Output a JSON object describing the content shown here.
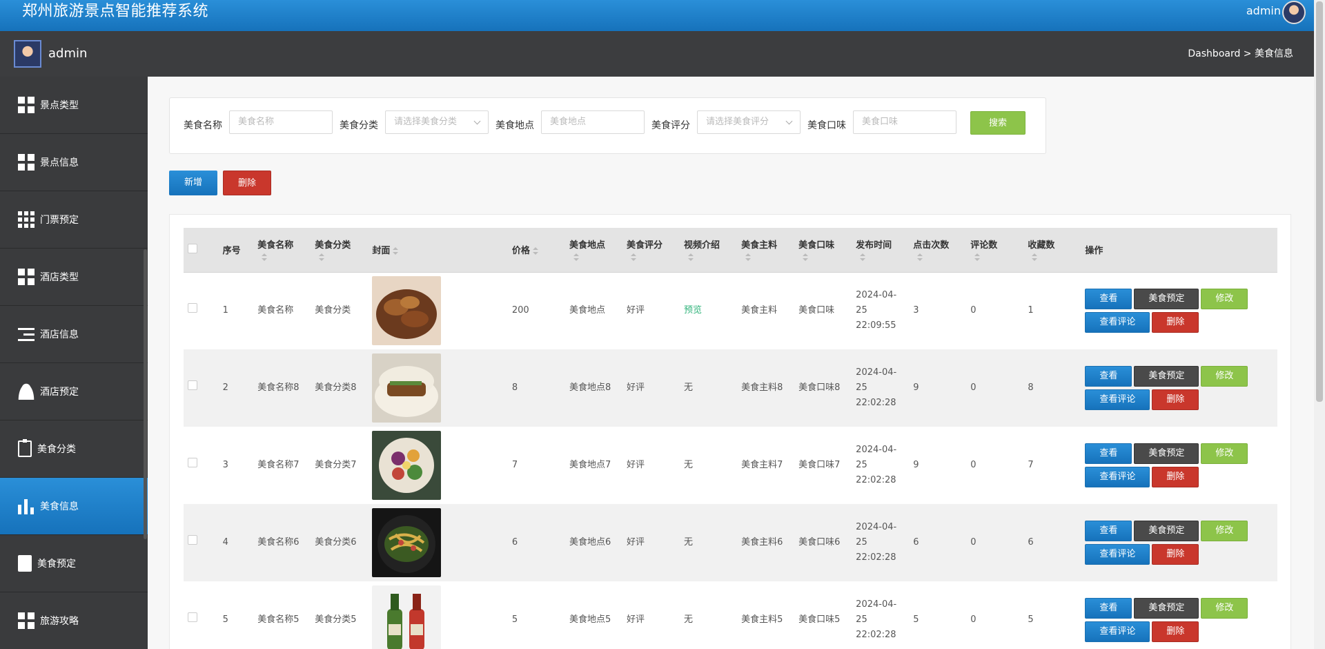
{
  "header": {
    "title": "郑州旅游景点智能推荐系统",
    "user": "admin"
  },
  "subbar": {
    "user": "admin",
    "breadcrumb": "Dashboard > 美食信息"
  },
  "sidebar": {
    "items": [
      {
        "label": "景点类型",
        "icon": "grid-icon"
      },
      {
        "label": "景点信息",
        "icon": "grid-icon"
      },
      {
        "label": "门票预定",
        "icon": "apps-icon"
      },
      {
        "label": "酒店类型",
        "icon": "grid-icon"
      },
      {
        "label": "酒店信息",
        "icon": "list-icon"
      },
      {
        "label": "酒店预定",
        "icon": "user-icon"
      },
      {
        "label": "美食分类",
        "icon": "clipboard-x-icon"
      },
      {
        "label": "美食信息",
        "icon": "bar-chart-icon",
        "active": true
      },
      {
        "label": "美食预定",
        "icon": "clipboard-check-icon"
      },
      {
        "label": "旅游攻略",
        "icon": "grid-icon"
      }
    ]
  },
  "filters": {
    "name_label": "美食名称",
    "name_placeholder": "美食名称",
    "category_label": "美食分类",
    "category_placeholder": "请选择美食分类",
    "location_label": "美食地点",
    "location_placeholder": "美食地点",
    "rating_label": "美食评分",
    "rating_placeholder": "请选择美食评分",
    "taste_label": "美食口味",
    "taste_placeholder": "美食口味",
    "search_label": "搜索"
  },
  "actions": {
    "add_label": "新增",
    "delete_label": "删除"
  },
  "table": {
    "headers": {
      "seq": "序号",
      "name": "美食名称",
      "category": "美食分类",
      "cover": "封面",
      "price": "价格",
      "location": "美食地点",
      "rating": "美食评分",
      "video": "视频介绍",
      "main": "美食主料",
      "taste": "美食口味",
      "time": "发布时间",
      "clicks": "点击次数",
      "comments": "评论数",
      "favorites": "收藏数",
      "ops": "操作"
    },
    "op_labels": {
      "view": "查看",
      "book": "美食预定",
      "edit": "修改",
      "comment": "查看评论",
      "delete": "删除"
    },
    "rows": [
      {
        "seq": "1",
        "name": "美食名称",
        "category": "美食分类",
        "price": "200",
        "location": "美食地点",
        "rating": "好评",
        "video": "预览",
        "main": "美食主料",
        "taste": "美食口味",
        "time": "2024-04-25 22:09:55",
        "clicks": "3",
        "comments": "0",
        "favorites": "1"
      },
      {
        "seq": "2",
        "name": "美食名称8",
        "category": "美食分类8",
        "price": "8",
        "location": "美食地点8",
        "rating": "好评",
        "video": "无",
        "main": "美食主料8",
        "taste": "美食口味8",
        "time": "2024-04-25 22:02:28",
        "clicks": "9",
        "comments": "0",
        "favorites": "8"
      },
      {
        "seq": "3",
        "name": "美食名称7",
        "category": "美食分类7",
        "price": "7",
        "location": "美食地点7",
        "rating": "好评",
        "video": "无",
        "main": "美食主料7",
        "taste": "美食口味7",
        "time": "2024-04-25 22:02:28",
        "clicks": "9",
        "comments": "0",
        "favorites": "7"
      },
      {
        "seq": "4",
        "name": "美食名称6",
        "category": "美食分类6",
        "price": "6",
        "location": "美食地点6",
        "rating": "好评",
        "video": "无",
        "main": "美食主料6",
        "taste": "美食口味6",
        "time": "2024-04-25 22:02:28",
        "clicks": "6",
        "comments": "0",
        "favorites": "6"
      },
      {
        "seq": "5",
        "name": "美食名称5",
        "category": "美食分类5",
        "price": "5",
        "location": "美食地点5",
        "rating": "好评",
        "video": "无",
        "main": "美食主料5",
        "taste": "美食口味5",
        "time": "2024-04-25 22:02:28",
        "clicks": "5",
        "comments": "0",
        "favorites": "5"
      }
    ]
  },
  "colors": {
    "primary": "#1672bb",
    "success": "#8dc44a",
    "danger": "#c9372c",
    "dark": "#3c3d3f",
    "preview": "#2fb37a"
  }
}
